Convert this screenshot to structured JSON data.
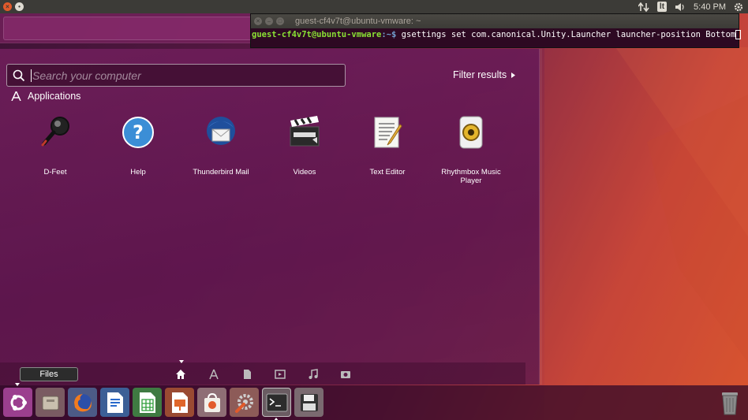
{
  "top_panel": {
    "close_glyph": "×",
    "restore_glyph": "•",
    "keyboard_layout": "lt",
    "time": "5:40 PM",
    "icons": [
      "network-arrows-icon",
      "keyboard-icon",
      "volume-icon",
      "gear-icon"
    ]
  },
  "terminal": {
    "title": "guest-cf4v7t@ubuntu-vmware: ~",
    "prompt_user": "guest-cf4v7t@ubuntu-vmware",
    "prompt_path": ":~$ ",
    "command": "gsettings set com.canonical.Unity.Launcher launcher-position Bottom"
  },
  "dash": {
    "search_placeholder": "Search your computer",
    "filter_label": "Filter results",
    "category": "Applications",
    "apps": [
      {
        "label": "D-Feet",
        "icon": "magnifier-icon"
      },
      {
        "label": "Help",
        "icon": "help-icon"
      },
      {
        "label": "Thunderbird Mail",
        "icon": "thunderbird-icon"
      },
      {
        "label": "Videos",
        "icon": "clapperboard-icon"
      },
      {
        "label": "Text Editor",
        "icon": "text-editor-icon"
      },
      {
        "label": "Rhythmbox Music Player",
        "icon": "rhythmbox-icon"
      }
    ],
    "lenses": [
      "home-icon",
      "applications-icon",
      "files-icon",
      "video-icon",
      "music-icon",
      "photo-icon"
    ]
  },
  "tooltip": "Files",
  "launcher": {
    "items": [
      "ubuntu-dash-icon",
      "files-icon",
      "firefox-icon",
      "writer-icon",
      "calc-icon",
      "impress-icon",
      "software-center-icon",
      "system-settings-icon",
      "terminal-icon",
      "save-icon"
    ],
    "trash": "trash-icon"
  },
  "colors": {
    "accent": "#e25a2b",
    "prompt_user": "#8ae234",
    "prompt_path": "#729fcf",
    "panel": "#3c3b37"
  }
}
